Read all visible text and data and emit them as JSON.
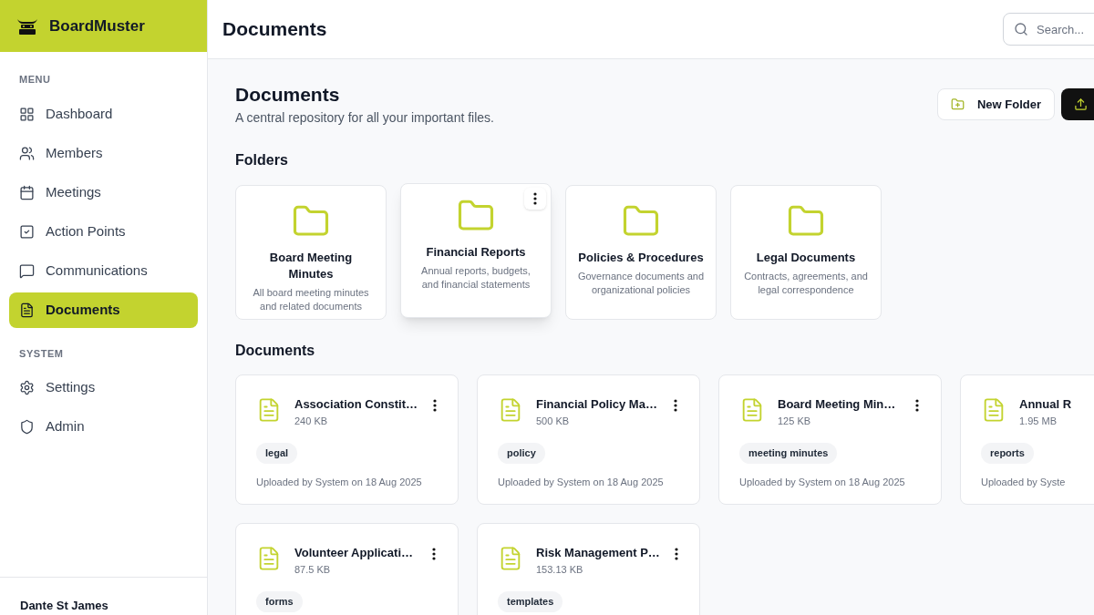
{
  "app": {
    "name": "BoardMuster"
  },
  "sidebar": {
    "sections": [
      {
        "heading": "MENU",
        "items": [
          {
            "label": "Dashboard",
            "selected": false
          },
          {
            "label": "Members",
            "selected": false
          },
          {
            "label": "Meetings",
            "selected": false
          },
          {
            "label": "Action Points",
            "selected": false
          },
          {
            "label": "Communications",
            "selected": false
          },
          {
            "label": "Documents",
            "selected": true
          }
        ]
      },
      {
        "heading": "SYSTEM",
        "items": [
          {
            "label": "Settings",
            "selected": false
          },
          {
            "label": "Admin",
            "selected": false
          }
        ]
      }
    ],
    "user": "Dante St James"
  },
  "header": {
    "title": "Documents",
    "search": {
      "placeholder": "Search..."
    }
  },
  "page": {
    "title": "Documents",
    "subtitle": "A central repository for all your important files.",
    "new_folder_button": "New Folder"
  },
  "folders": {
    "heading": "Folders",
    "items": [
      {
        "name": "Board Meeting Minutes",
        "description": "All board meeting minutes and related documents",
        "hovered": false
      },
      {
        "name": "Financial Reports",
        "description": "Annual reports, budgets, and financial statements",
        "hovered": true
      },
      {
        "name": "Policies & Procedures",
        "description": "Governance documents and organizational policies",
        "hovered": false
      },
      {
        "name": "Legal Documents",
        "description": "Contracts, agreements, and legal correspondence",
        "hovered": false
      }
    ]
  },
  "documents": {
    "heading": "Documents",
    "items": [
      {
        "name": "Association Constit…",
        "size": "240 KB",
        "tag": "legal",
        "uploaded": "Uploaded by System on 18 Aug 2025"
      },
      {
        "name": "Financial Policy Ma…",
        "size": "500 KB",
        "tag": "policy",
        "uploaded": "Uploaded by System on 18 Aug 2025"
      },
      {
        "name": "Board Meeting Min…",
        "size": "125 KB",
        "tag": "meeting minutes",
        "uploaded": "Uploaded by System on 18 Aug 2025"
      },
      {
        "name": "Annual R",
        "size": "1.95 MB",
        "tag": "reports",
        "uploaded": "Uploaded by Syste"
      },
      {
        "name": "Volunteer Applicati…",
        "size": "87.5 KB",
        "tag": "forms"
      },
      {
        "name": "Risk Management P…",
        "size": "153.13 KB",
        "tag": "templates"
      }
    ]
  }
}
